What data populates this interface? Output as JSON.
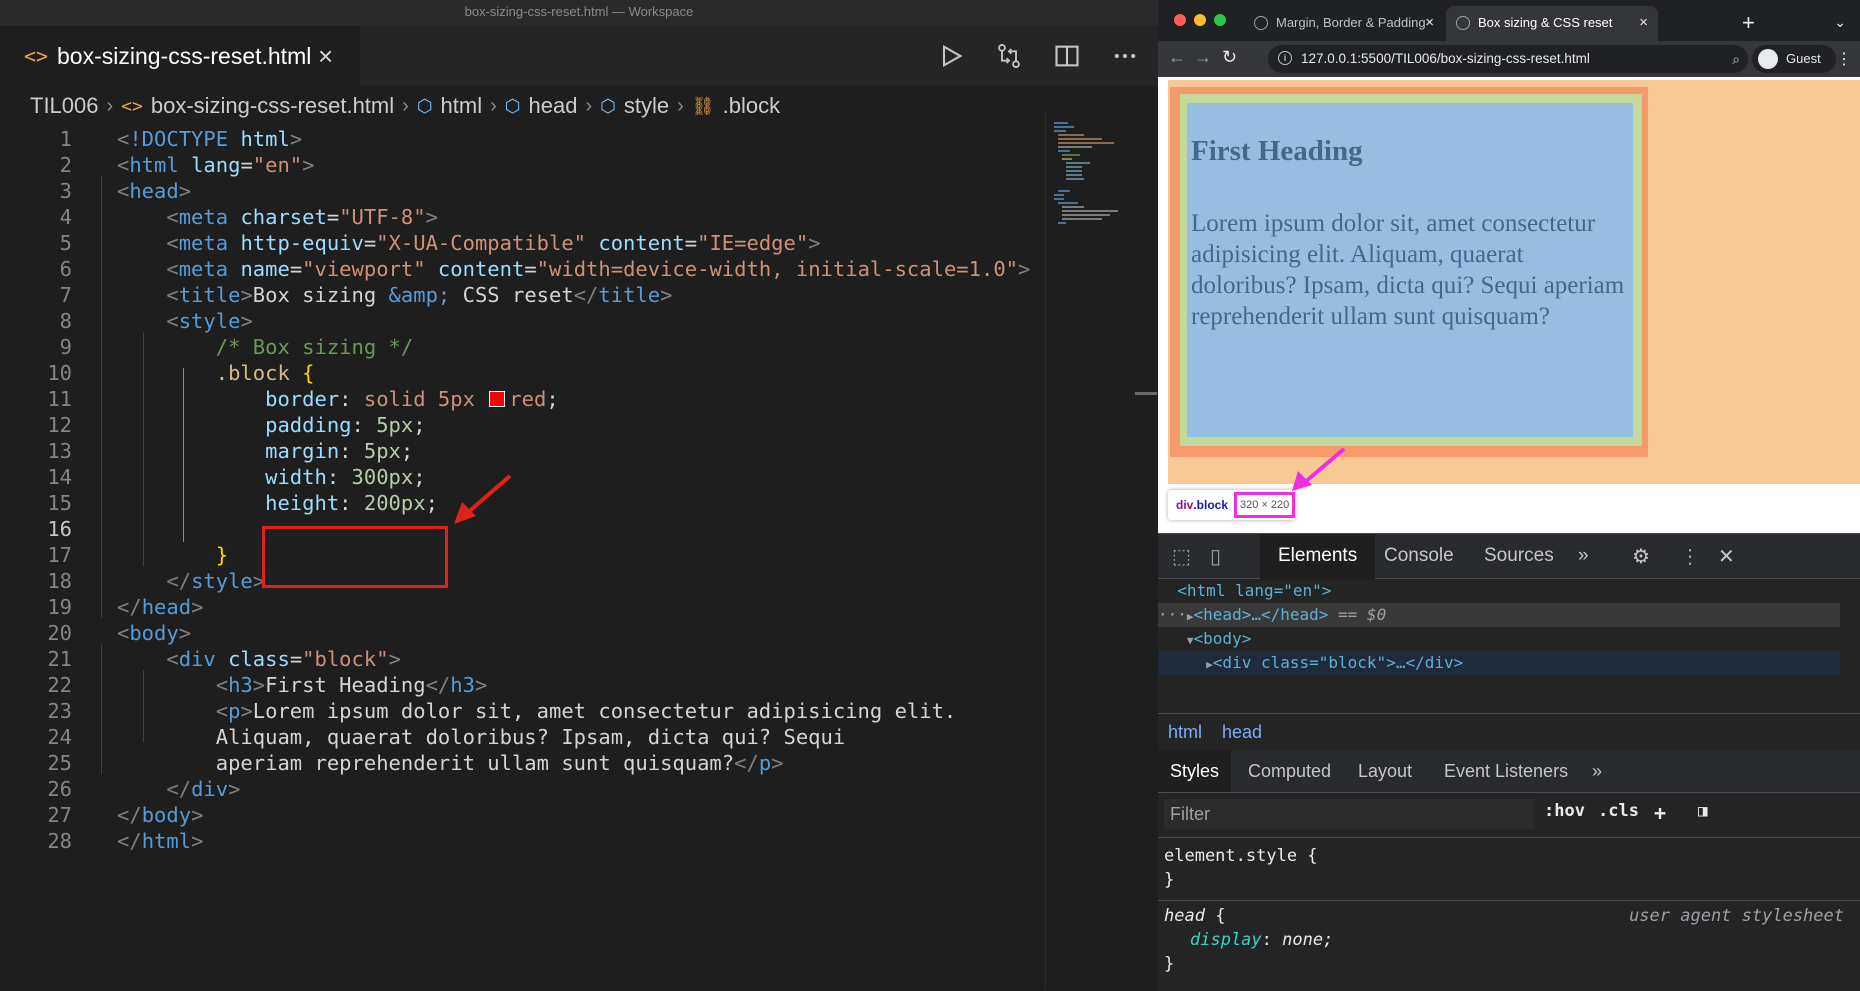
{
  "window_title": "box-sizing-css-reset.html — Workspace",
  "editor": {
    "tab_label": "box-sizing-css-reset.html",
    "breadcrumb": [
      "TIL006",
      "box-sizing-css-reset.html",
      "html",
      "head",
      "style",
      ".block"
    ],
    "lines": [
      "1",
      "2",
      "3",
      "4",
      "5",
      "6",
      "7",
      "8",
      "9",
      "10",
      "11",
      "12",
      "13",
      "14",
      "15",
      "16",
      "17",
      "18",
      "19",
      "20",
      "21",
      "22",
      "23",
      "24",
      "25",
      "26",
      "27",
      "28"
    ],
    "code": {
      "l1": "html",
      "l2_attr": "lang",
      "l2_val": "\"en\"",
      "l4_attr": "charset",
      "l4_val": "\"UTF-8\"",
      "l5_attr1": "http-equiv",
      "l5_val1": "\"X-UA-Compatible\"",
      "l5_attr2": "content",
      "l5_val2": "\"IE=edge\"",
      "l6_attr1": "name",
      "l6_val1": "\"viewport\"",
      "l6_attr2": "content",
      "l6_val2": "\"width=device-width, initial-scale=1.0\"",
      "l7_text1": "Box sizing ",
      "l7_entity": "&amp;",
      "l7_text2": " CSS reset",
      "l9_comment": "/* Box sizing */",
      "l10_selector": ".block",
      "l11_prop": "border",
      "l11_val": "solid 5px",
      "l11_color": "red",
      "l12_prop": "padding",
      "l12_val": "5px",
      "l13_prop": "margin",
      "l13_val": "5px",
      "l14_prop": "width",
      "l14_val": "300px",
      "l15_prop": "height",
      "l15_val": "200px",
      "l21_attr": "class",
      "l21_val": "\"block\"",
      "l22_text": "First Heading",
      "l23_text": "Lorem ipsum dolor sit, amet consectetur adipisicing elit.",
      "l24_text": "Aliquam, quaerat doloribus? Ipsam, dicta qui? Sequi",
      "l25_text": "aperiam reprehenderit ullam sunt quisquam?"
    }
  },
  "browser": {
    "tabs": [
      {
        "label": "Margin, Border & Padding",
        "active": false
      },
      {
        "label": "Box sizing & CSS reset",
        "active": true
      }
    ],
    "url": "127.0.0.1:5500/TIL006/box-sizing-css-reset.html",
    "profile": "Guest",
    "page": {
      "heading": "First Heading",
      "paragraph": "Lorem ipsum dolor sit, amet consectetur adipisicing elit. Aliquam, quaerat doloribus? Ipsam, dicta qui? Sequi aperiam reprehenderit ullam sunt quisquam?"
    },
    "tooltip": {
      "tag": "div",
      "class": ".block",
      "size": "320 × 220"
    }
  },
  "devtools": {
    "tabs": [
      "Elements",
      "Console",
      "Sources"
    ],
    "dom": {
      "html_open": "<html lang=\"en\">",
      "head": "<head>…</head>",
      "head_ref": "== $0",
      "body": "<body>",
      "div": "<div class=\"block\">…</div>"
    },
    "crumbs": [
      "html",
      "head"
    ],
    "styles_tabs": [
      "Styles",
      "Computed",
      "Layout",
      "Event Listeners"
    ],
    "filter_placeholder": "Filter",
    "hov": ":hov",
    "cls": ".cls",
    "rule1_selector": "element.style {",
    "rule1_close": "}",
    "rule2_selector": "head",
    "rule2_source": "user agent stylesheet",
    "rule2_prop": "display",
    "rule2_val": "none;",
    "rule2_close": "}"
  },
  "colors": {
    "highlight_box": "#e0201c",
    "size_highlight": "#ef2de2",
    "css_red_swatch": "#ff0000"
  }
}
